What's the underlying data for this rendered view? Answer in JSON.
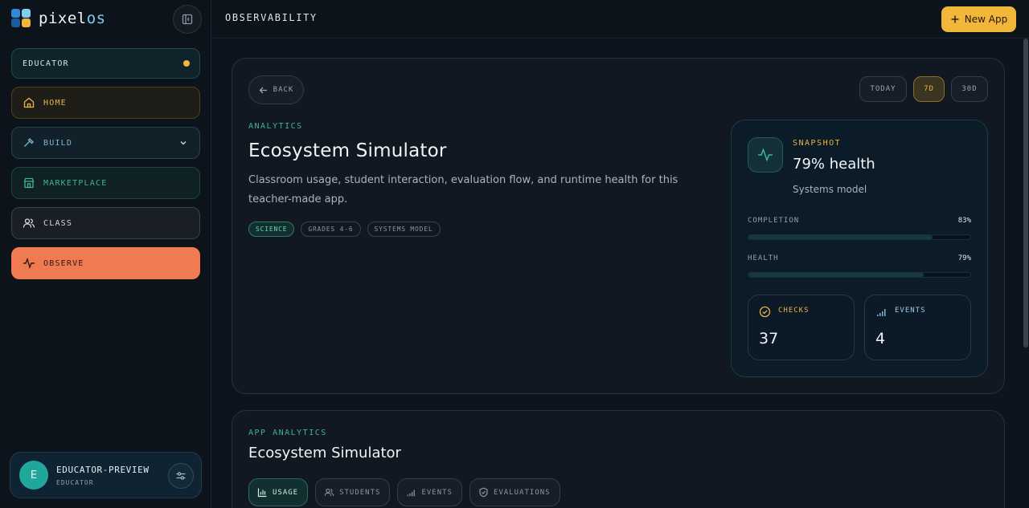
{
  "brand": {
    "name_prefix": "pixel",
    "name_suffix": "os"
  },
  "sidebar": {
    "role": "EDUCATOR",
    "items": [
      {
        "label": "HOME",
        "icon": "home-icon"
      },
      {
        "label": "BUILD",
        "icon": "hammer-icon"
      },
      {
        "label": "MARKETPLACE",
        "icon": "store-icon"
      },
      {
        "label": "CLASS",
        "icon": "users-icon"
      },
      {
        "label": "OBSERVE",
        "icon": "pulse-icon"
      }
    ],
    "user": {
      "initial": "E",
      "name": "EDUCATOR-PREVIEW",
      "role": "EDUCATOR"
    }
  },
  "topbar": {
    "title": "OBSERVABILITY",
    "new_app_label": "New App"
  },
  "detail": {
    "back_label": "BACK",
    "ranges": [
      "TODAY",
      "7D",
      "30D"
    ],
    "selected_range": "7D",
    "eyebrow": "ANALYTICS",
    "title": "Ecosystem Simulator",
    "description": "Classroom usage, student interaction, evaluation flow, and runtime health for this teacher-made app.",
    "tags": [
      "SCIENCE",
      "GRADES 4-6",
      "SYSTEMS MODEL"
    ]
  },
  "snapshot": {
    "label": "SNAPSHOT",
    "value": "79% health",
    "subtitle": "Systems model",
    "completion": {
      "label": "COMPLETION",
      "value": "83%",
      "fraction": 0.83
    },
    "health": {
      "label": "HEALTH",
      "value": "79%",
      "fraction": 0.79
    },
    "checks": {
      "label": "CHECKS",
      "value": "37"
    },
    "events": {
      "label": "EVENTS",
      "value": "4"
    }
  },
  "app_analytics": {
    "eyebrow": "APP ANALYTICS",
    "title": "Ecosystem Simulator",
    "tabs": [
      "USAGE",
      "STUDENTS",
      "EVENTS",
      "EVALUATIONS"
    ],
    "active_tab": "USAGE"
  },
  "colors": {
    "accent_gold": "#f2b63a",
    "accent_teal": "#3fb1a1",
    "observe_orange": "#f07b52"
  }
}
